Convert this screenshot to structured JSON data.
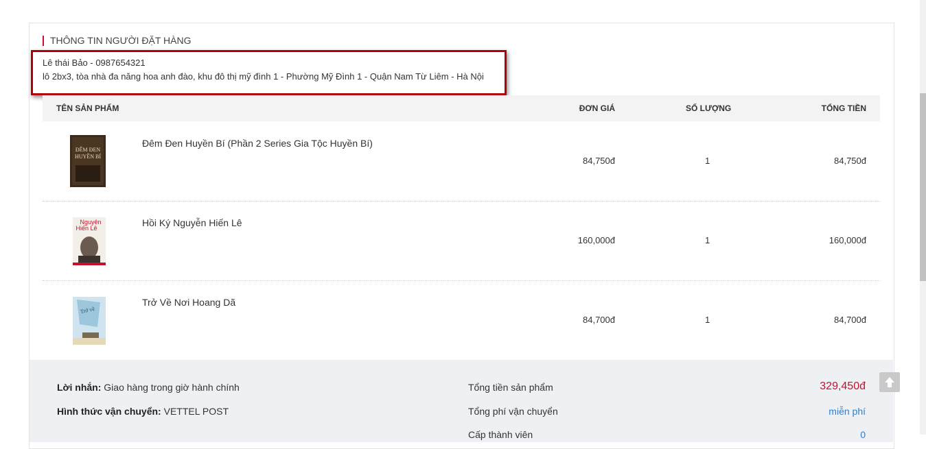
{
  "orderer": {
    "section_title": "THÔNG TIN NGƯỜI ĐẶT HÀNG",
    "name_phone": "Lê thái Bảo - 0987654321",
    "address": "lô 2bx3, tòa nhà đa năng hoa anh đào, khu đô thị mỹ đình 1 - Phường Mỹ Đình 1 - Quận Nam Từ Liêm - Hà Nội"
  },
  "table": {
    "headers": {
      "name": "TÊN SẢN PHẨM",
      "price": "ĐƠN GIÁ",
      "qty": "SỐ LƯỢNG",
      "total": "TỔNG TIỀN"
    },
    "rows": [
      {
        "name": "Đêm Đen Huyền Bí (Phần 2 Series Gia Tộc Huyền Bí)",
        "price": "84,750đ",
        "qty": "1",
        "total": "84,750đ",
        "cover_text": "ĐÊM ĐEN HUYỀN BÍ"
      },
      {
        "name": "Hồi Ký Nguyễn Hiến Lê",
        "price": "160,000đ",
        "qty": "1",
        "total": "160,000đ",
        "cover_text": "Nguyễn Hiến Lê"
      },
      {
        "name": "Trở Về Nơi Hoang Dã",
        "price": "84,700đ",
        "qty": "1",
        "total": "84,700đ",
        "cover_text": "Trở về"
      }
    ]
  },
  "summary": {
    "note_label": "Lời nhắn:",
    "note_value": "Giao hàng trong giờ hành chính",
    "shipping_label": "Hình thức vận chuyển:",
    "shipping_value": "VETTEL POST",
    "subtotal_label": "Tổng tiền sản phẩm",
    "subtotal_value": "329,450đ",
    "shipping_fee_label": "Tổng phí vận chuyển",
    "shipping_fee_value": "miễn phí",
    "member_label": "Cấp thành viên",
    "member_value": "0"
  },
  "colors": {
    "accent": "#c8102e",
    "link": "#2b7fcf",
    "highlight_border": "#b0000a"
  },
  "icons": {
    "scroll_top": "arrow-up-icon"
  }
}
